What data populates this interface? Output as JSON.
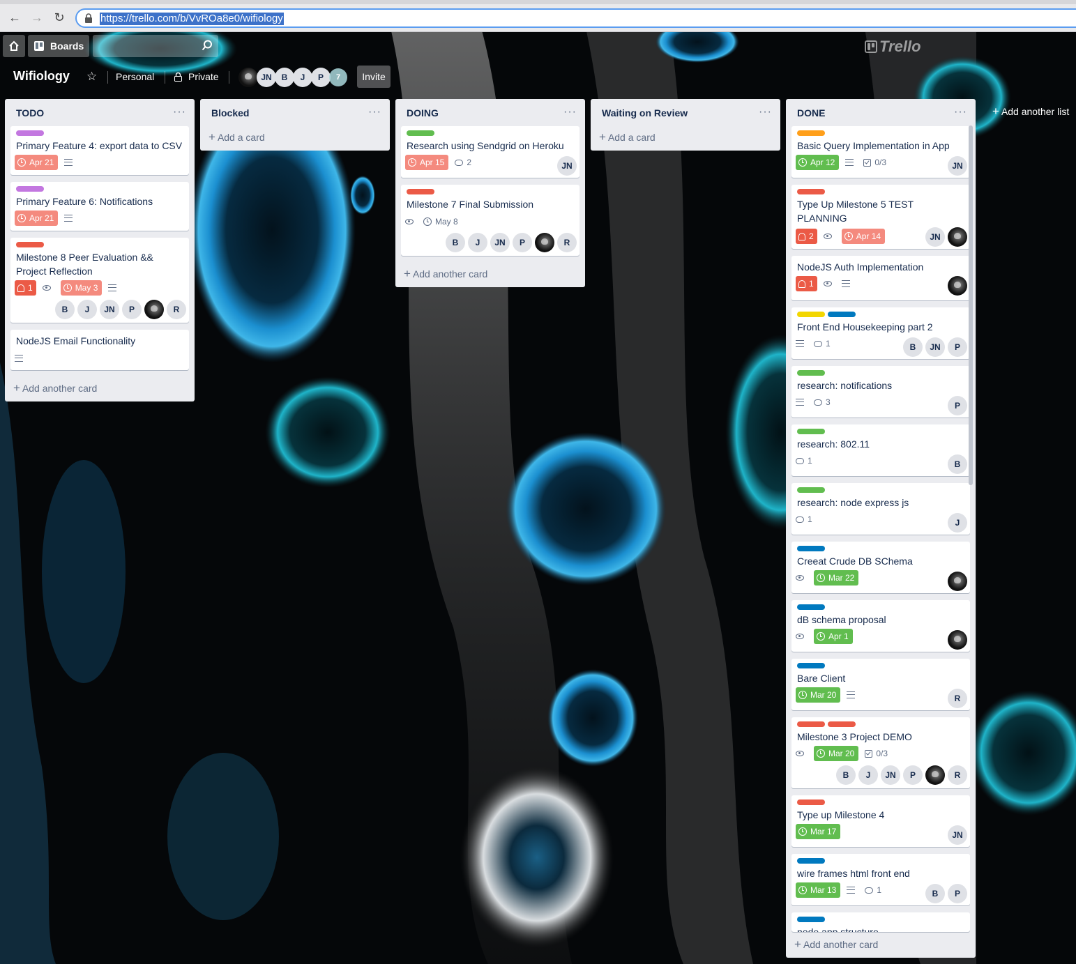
{
  "browser": {
    "url": "https://trello.com/b/VvROa8e0/wifiology"
  },
  "header": {
    "boards_label": "Boards",
    "logo_text": "Trello"
  },
  "board": {
    "title": "Wifiology",
    "team": "Personal",
    "visibility": "Private",
    "members": [
      "JN",
      "B",
      "J",
      "P"
    ],
    "member_count": "7",
    "invite_label": "Invite",
    "add_list_label": "Add another list"
  },
  "colors": {
    "label_purple": "#c377e0",
    "label_green": "#61bd4f",
    "label_red": "#eb5a46",
    "label_orange": "#ff9f1a",
    "label_yellow": "#f2d600",
    "label_blue": "#0079bf",
    "due_red": "#f48a7e",
    "due_green": "#61bd4f"
  },
  "lists": [
    {
      "title": "TODO",
      "add_label": "Add another card",
      "cards": [
        {
          "title": "Primary Feature 4: export data to CSV",
          "due": "Apr 21"
        },
        {
          "title": "Primary Feature 6: Notifications",
          "due": "Apr 21"
        },
        {
          "title": "Milestone 8 Peer Evaluation && Project Reflection",
          "alerts": "1",
          "due": "May 3",
          "members": [
            "B",
            "J",
            "JN",
            "P",
            "",
            "R"
          ]
        },
        {
          "title": "NodeJS Email Functionality"
        }
      ]
    },
    {
      "title": "Blocked",
      "add_label": "Add a card",
      "cards": []
    },
    {
      "title": "DOING",
      "add_label": "Add another card",
      "cards": [
        {
          "title": "Research using Sendgrid on Heroku",
          "due": "Apr 15",
          "comments": "2",
          "members": [
            "JN"
          ]
        },
        {
          "title": "Milestone 7 Final Submission",
          "due": "May 8",
          "members": [
            "B",
            "J",
            "JN",
            "P",
            "",
            "R"
          ]
        }
      ]
    },
    {
      "title": "Waiting on Review",
      "add_label": "Add a card",
      "cards": []
    },
    {
      "title": "DONE",
      "add_label": "Add another card",
      "cards": [
        {
          "title": "Basic Query Implementation in App",
          "due": "Apr 12",
          "checklist": "0/3",
          "members": [
            "JN"
          ]
        },
        {
          "title": "Type Up Milestone 5 TEST PLANNING",
          "alerts": "2",
          "due": "Apr 14",
          "members": [
            "JN",
            ""
          ]
        },
        {
          "title": "NodeJS Auth Implementation",
          "alerts": "1",
          "members": [
            ""
          ]
        },
        {
          "title": "Front End Housekeeping part 2",
          "comments": "1",
          "members": [
            "B",
            "JN",
            "P"
          ]
        },
        {
          "title": "research: notifications",
          "comments": "3",
          "members": [
            "P"
          ]
        },
        {
          "title": "research: 802.11",
          "comments": "1",
          "members": [
            "B"
          ]
        },
        {
          "title": "research: node express js",
          "comments": "1",
          "members": [
            "J"
          ]
        },
        {
          "title": "Creeat Crude DB SChema",
          "due": "Mar 22",
          "members": [
            ""
          ]
        },
        {
          "title": "dB schema proposal",
          "due": "Apr 1",
          "members": [
            ""
          ]
        },
        {
          "title": "Bare Client",
          "due": "Mar 20",
          "members": [
            "R"
          ]
        },
        {
          "title": "Milestone 3 Project DEMO",
          "due": "Mar 20",
          "checklist": "0/3",
          "members": [
            "B",
            "J",
            "JN",
            "P",
            "",
            "R"
          ]
        },
        {
          "title": "Type up Milestone 4",
          "due": "Mar 17",
          "members": [
            "JN"
          ]
        },
        {
          "title": "wire frames html front end",
          "due": "Mar 13",
          "comments": "1",
          "members": [
            "B",
            "P"
          ]
        },
        {
          "title": "node app structure"
        }
      ]
    }
  ]
}
